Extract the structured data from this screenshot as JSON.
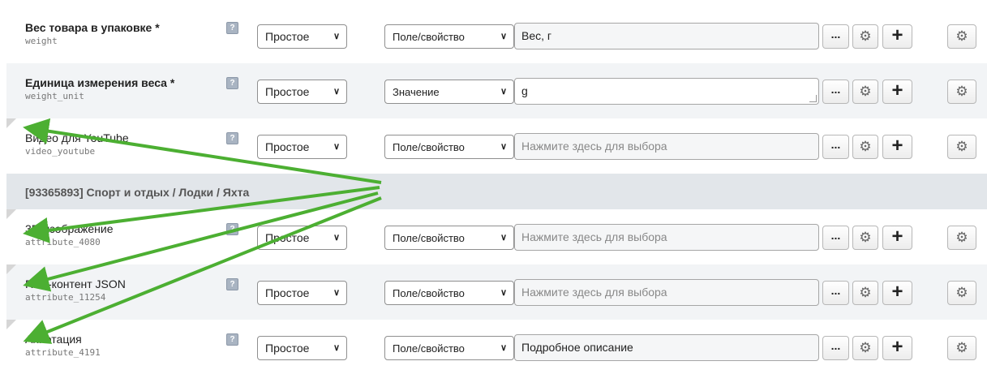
{
  "help_glyph": "?",
  "dots_label": "...",
  "plus_label": "+",
  "gear_glyph": "⚙",
  "chevron_glyph": "✓",
  "rows": [
    {
      "title": "Вес товара в упаковке *",
      "code": "weight",
      "bold": true,
      "type": "Простое",
      "source": "Поле/свойство",
      "value": "Вес, г",
      "placeholder": false
    },
    {
      "title": "Единица измерения веса *",
      "code": "weight_unit",
      "bold": true,
      "type": "Простое",
      "source": "Значение",
      "value": "g",
      "placeholder": false
    },
    {
      "title": "Видео для YouTube",
      "code": "video_youtube",
      "bold": false,
      "type": "Простое",
      "source": "Поле/свойство",
      "value": "Нажмите здесь для выбора",
      "placeholder": true
    }
  ],
  "group": {
    "title": "[93365893] Спорт и отдых / Лодки / Яхта"
  },
  "rows2": [
    {
      "title": "3D-изображение",
      "code": "attribute_4080",
      "bold": false,
      "type": "Простое",
      "source": "Поле/свойство",
      "value": "Нажмите здесь для выбора",
      "placeholder": true
    },
    {
      "title": "Rich-контент JSON",
      "code": "attribute_11254",
      "bold": false,
      "type": "Простое",
      "source": "Поле/свойство",
      "value": "Нажмите здесь для выбора",
      "placeholder": true
    },
    {
      "title": "Аннотация",
      "code": "attribute_4191",
      "bold": false,
      "type": "Простое",
      "source": "Поле/свойство",
      "value": "Подробное описание",
      "placeholder": false
    }
  ],
  "colors": {
    "arrow": "#4caf32",
    "group_bg": "#e2e6ea",
    "row_alt_bg": "#f2f4f6"
  }
}
